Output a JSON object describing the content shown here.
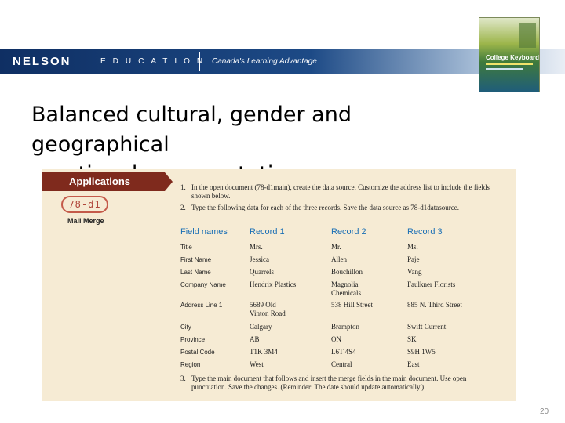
{
  "header": {
    "logo": "NELSON",
    "division": "EDUCATION",
    "tagline": "Canada's Learning Advantage"
  },
  "cover": {
    "title": "College Keyboarding"
  },
  "slide": {
    "title_line1": "Balanced cultural, gender and geographical",
    "title_line2": "national representation",
    "page_number": "20"
  },
  "textbook": {
    "heading": "Applications",
    "code": "78-d1",
    "section": "Mail Merge",
    "instructions": [
      {
        "num": "1.",
        "text": "In the open document (78-d1main), create the data source. Customize the address list to include the fields shown below."
      },
      {
        "num": "2.",
        "text": "Type the following data for each of the three records. Save the data source as 78-d1datasource."
      },
      {
        "num": "3.",
        "text": "Type the main document that follows and insert the merge fields in the main document. Use open punctuation. Save the changes. (Reminder: The date should update automatically.)"
      }
    ],
    "table": {
      "headers": [
        "Field names",
        "Record 1",
        "Record 2",
        "Record 3"
      ],
      "rows": [
        [
          "Title",
          "Mrs.",
          "Mr.",
          "Ms."
        ],
        [
          "First Name",
          "Jessica",
          "Allen",
          "Paje"
        ],
        [
          "Last Name",
          "Quarrels",
          "Bouchillon",
          "Vang"
        ],
        [
          "Company Name",
          "Hendrix Plastics",
          "Magnolia Chemicals",
          "Faulkner Florists"
        ],
        [
          "Address Line 1",
          "5689 Old Vinton Road",
          "538 Hill Street",
          "885 N. Third Street"
        ],
        [
          "City",
          "Calgary",
          "Brampton",
          "Swift Current"
        ],
        [
          "Province",
          "AB",
          "ON",
          "SK"
        ],
        [
          "Postal Code",
          "T1K 3M4",
          "L6T 4S4",
          "S9H 1W5"
        ],
        [
          "Region",
          "West",
          "Central",
          "East"
        ]
      ]
    }
  }
}
